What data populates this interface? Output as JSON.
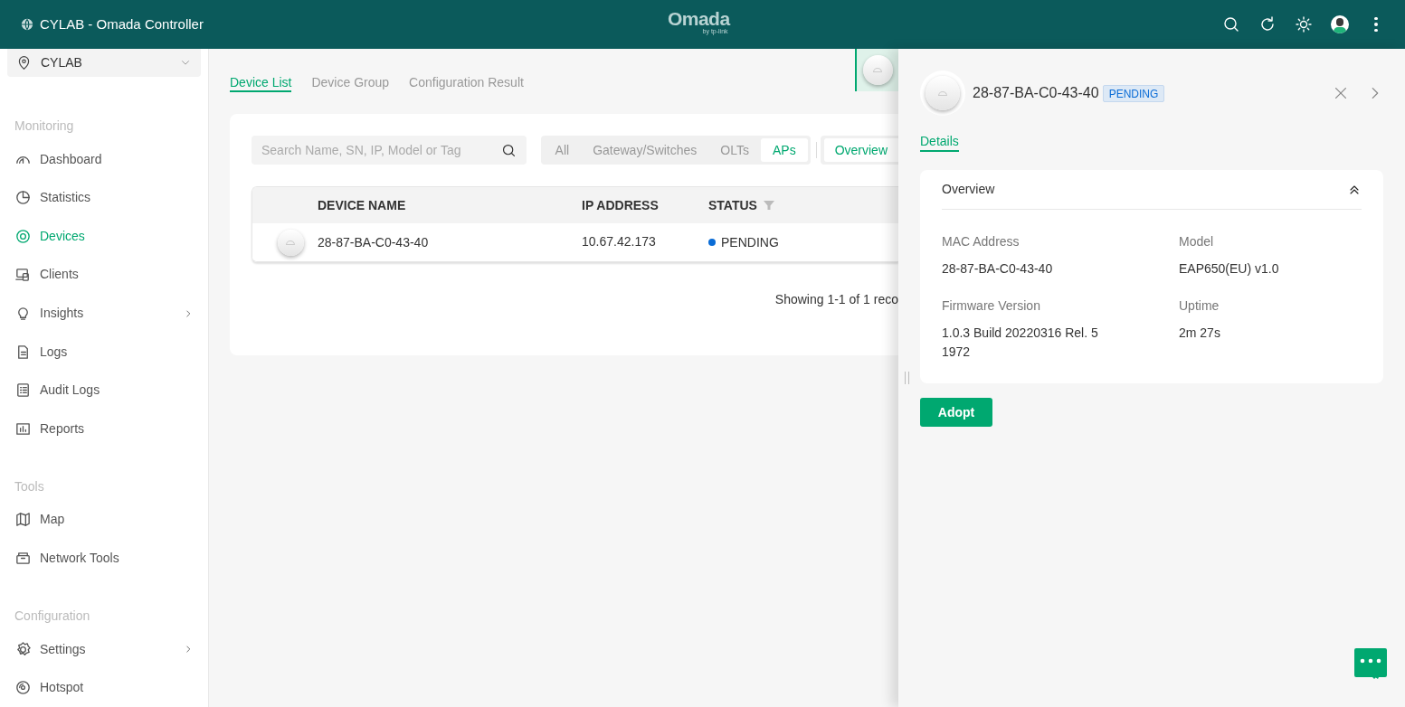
{
  "topbar": {
    "title": "CYLAB - Omada Controller",
    "logo": "Omada",
    "logo_sub": "by tp-link"
  },
  "sidebar": {
    "site": "CYLAB",
    "sections": [
      {
        "heading": "Monitoring",
        "items": [
          {
            "label": "Dashboard",
            "selected": false,
            "submenu": false
          },
          {
            "label": "Statistics",
            "selected": false,
            "submenu": false
          },
          {
            "label": "Devices",
            "selected": true,
            "submenu": false
          },
          {
            "label": "Clients",
            "selected": false,
            "submenu": false
          },
          {
            "label": "Insights",
            "selected": false,
            "submenu": true
          },
          {
            "label": "Logs",
            "selected": false,
            "submenu": false
          },
          {
            "label": "Audit Logs",
            "selected": false,
            "submenu": false
          },
          {
            "label": "Reports",
            "selected": false,
            "submenu": false
          }
        ]
      },
      {
        "heading": "Tools",
        "items": [
          {
            "label": "Map",
            "selected": false,
            "submenu": false
          },
          {
            "label": "Network Tools",
            "selected": false,
            "submenu": false
          }
        ]
      },
      {
        "heading": "Configuration",
        "items": [
          {
            "label": "Settings",
            "selected": false,
            "submenu": true
          },
          {
            "label": "Hotspot",
            "selected": false,
            "submenu": false
          }
        ]
      }
    ]
  },
  "tabs": [
    {
      "label": "Device List",
      "selected": true
    },
    {
      "label": "Device Group",
      "selected": false
    },
    {
      "label": "Configuration Result",
      "selected": false
    }
  ],
  "search": {
    "placeholder": "Search Name, SN, IP, Model or Tag"
  },
  "filters": [
    {
      "label": "All",
      "selected": false
    },
    {
      "label": "Gateway/Switches",
      "selected": false
    },
    {
      "label": "OLTs",
      "selected": false
    },
    {
      "label": "APs",
      "selected": true
    }
  ],
  "view": {
    "label": "Overview",
    "selected": true
  },
  "table": {
    "columns": [
      "DEVICE NAME",
      "IP ADDRESS",
      "STATUS"
    ],
    "rows": [
      {
        "name": "28-87-BA-C0-43-40",
        "ip": "10.67.42.173",
        "status": "PENDING",
        "color": "#0a6cd6"
      }
    ]
  },
  "pagination": "Showing 1-1 of 1 reco",
  "drawer": {
    "title": "28-87-BA-C0-43-40",
    "badge": "PENDING",
    "tabs": [
      {
        "label": "Details",
        "selected": true
      }
    ],
    "section": {
      "title": "Overview",
      "expanded": true,
      "fields": [
        {
          "label": "MAC Address",
          "value": "28-87-BA-C0-43-40"
        },
        {
          "label": "Model",
          "value": "EAP650(EU) v1.0"
        },
        {
          "label": "Firmware Version",
          "value": "1.0.3 Build 20220316 Rel. 5 1972"
        },
        {
          "label": "Uptime",
          "value": "2m 27s"
        }
      ]
    },
    "button": "Adopt"
  }
}
